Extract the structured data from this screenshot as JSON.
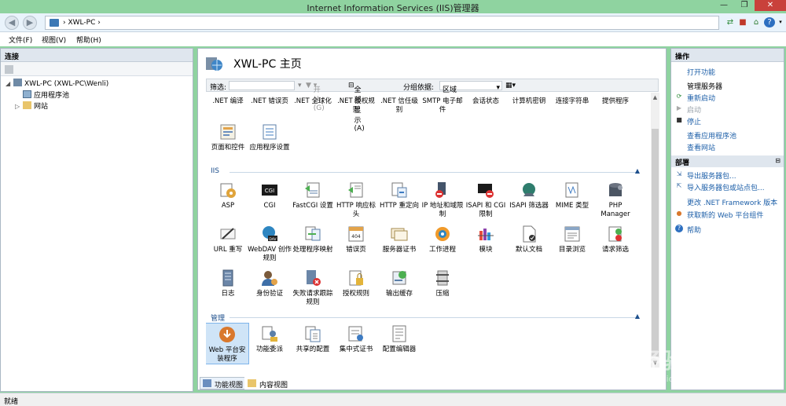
{
  "window": {
    "title": "Internet Information Services (IIS)管理器",
    "buttons": {
      "minimize": "—",
      "maximize": "❐",
      "close": "✕"
    }
  },
  "addressbar": {
    "path": "XWL-PC",
    "separator": "›",
    "icons": [
      "network-icon",
      "refresh-icon",
      "stop-icon",
      "home-icon",
      "help-icon"
    ]
  },
  "menu": {
    "file": "文件(F)",
    "view": "视图(V)",
    "help": "帮助(H)"
  },
  "connections": {
    "header": "连接",
    "tree": [
      {
        "label": "XWL-PC (XWL-PC\\Wenli)",
        "icon": "server-icon"
      },
      {
        "label": "应用程序池",
        "icon": "app-pools-icon"
      },
      {
        "label": "网站",
        "icon": "sites-folder-icon"
      }
    ]
  },
  "main": {
    "title": "XWL-PC 主页",
    "filter": {
      "filter_label": "筛选:",
      "start_label": "开始(G)",
      "show_all_label": "全部显示(A)",
      "group_by_label": "分组依据:",
      "group_by_value": "区域"
    },
    "aspnet_row1": [
      ".NET 编译",
      ".NET 错误页",
      ".NET 全球化",
      ".NET 授权规则",
      ".NET 信任级别",
      "SMTP 电子邮件",
      "会话状态",
      "计算机密钥",
      "连接字符串",
      "提供程序"
    ],
    "aspnet_row2": [
      "页面和控件",
      "应用程序设置"
    ],
    "iis_group": "IIS",
    "iis_row1": [
      "ASP",
      "CGI",
      "FastCGI 设置",
      "HTTP 响应标头",
      "HTTP 重定向",
      "IP 地址和域限制",
      "ISAPI 和 CGI 限制",
      "ISAPI 筛选器",
      "MIME 类型",
      "PHP Manager"
    ],
    "iis_row2": [
      "URL 重写",
      "WebDAV 创作规则",
      "处理程序映射",
      "错误页",
      "服务器证书",
      "工作进程",
      "模块",
      "默认文档",
      "目录浏览",
      "请求筛选"
    ],
    "iis_row3": [
      "日志",
      "身份验证",
      "失败请求跟踪规则",
      "授权规则",
      "输出缓存",
      "压缩"
    ],
    "mgmt_group": "管理",
    "mgmt_row": [
      "Web 平台安装程序",
      "功能委派",
      "共享的配置",
      "集中式证书",
      "配置编辑器"
    ]
  },
  "viewtabs": {
    "features": "功能视图",
    "content": "内容视图"
  },
  "actions": {
    "header": "操作",
    "open_feature": "打开功能",
    "manage_server": "管理服务器",
    "restart": "重新启动",
    "start": "启动",
    "stop": "停止",
    "view_app_pools": "查看应用程序池",
    "view_sites": "查看网站",
    "deploy_header": "部署",
    "export_server_pkg": "导出服务器包...",
    "import_server_pkg": "导入服务器包或站点包...",
    "change_framework": "更改 .NET Framework 版本",
    "get_platform": "获取新的 Web 平台组件",
    "help": "帮助"
  },
  "status": {
    "text": "就绪"
  },
  "watermark": {
    "main": "Bai经验",
    "sub": "jingyan.baidu.com"
  },
  "colors": {
    "titlebar": "#8fd3a0",
    "link": "#1d5fa8",
    "group": "#1d4f8c",
    "selected": "#cfe4f7"
  }
}
